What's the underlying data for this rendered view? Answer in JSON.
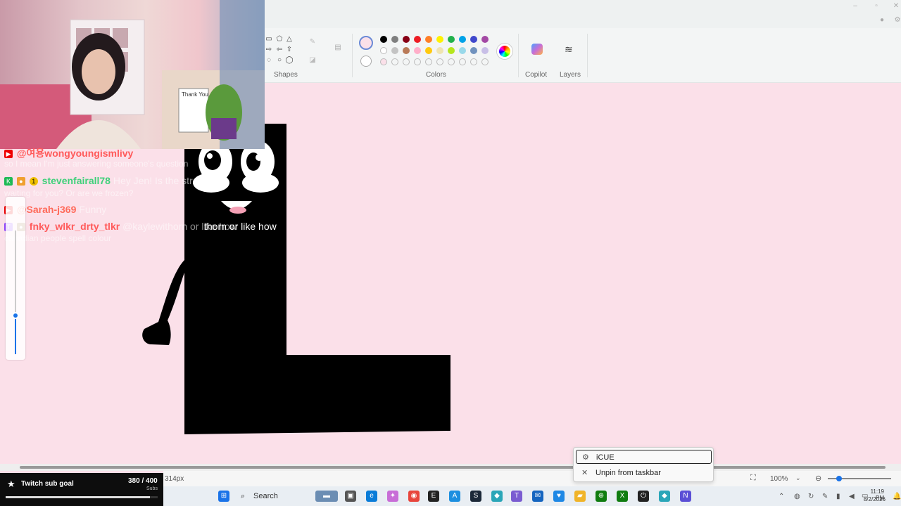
{
  "toolbar": {
    "groups": {
      "shapes": "Shapes",
      "colors": "Colors",
      "copilot": "Copilot",
      "layers": "Layers"
    },
    "palette_row1": [
      "#000000",
      "#7f7f7f",
      "#880015",
      "#ed1c24",
      "#ff7f27",
      "#fff200",
      "#22b14c",
      "#00a2e8",
      "#3f48cc",
      "#a349a4"
    ],
    "palette_row2": [
      "#ffffff",
      "#c3c3c3",
      "#b97a57",
      "#ffaec9",
      "#ffc90e",
      "#efe4b0",
      "#b5e61d",
      "#99d9ea",
      "#7092be",
      "#c8bfe7"
    ],
    "active_color": "#fbe0e9"
  },
  "chat": {
    "messages": [
      {
        "user": "@여용wongyoungismlivy",
        "user_color": "#ff5a5a",
        "text": "",
        "continuation": "so I mean I'm just answering someone's question"
      },
      {
        "user": "stevenfairall78",
        "user_color": "#3fd07a",
        "text": "Hey Jen! Is the stream la",
        "continuation": "waiting for you? Or are we frozen?"
      },
      {
        "user": "@Sarah-j369",
        "user_color": "#ff6a5a",
        "text": "Funny",
        "continuation": ""
      },
      {
        "user": "fnky_wlkr_drty_tlkr",
        "user_color": "#ff5a5a",
        "text": "@kaylewithorn or like how",
        "continuation": "canadian people spell colour"
      }
    ],
    "drawing_overlay_text": "thorn or like how"
  },
  "webcam": {
    "note_text": "Thank You"
  },
  "subgoal": {
    "label": "Twitch sub goal",
    "current": 380,
    "target": 400,
    "count_text": "380 / 400",
    "unit": "Subs",
    "progress": 0.95
  },
  "statusbar": {
    "size_text": "314px",
    "zoom": "100%"
  },
  "context_menu": {
    "items": [
      {
        "label": "iCUE",
        "icon": "icue-icon"
      },
      {
        "label": "Unpin from taskbar",
        "icon": "unpin-icon"
      }
    ]
  },
  "taskbar": {
    "search_label": "Search",
    "time": "11:19 PM",
    "date": "8/2/2026"
  },
  "drawing": {
    "eye_badge": "🙂"
  }
}
